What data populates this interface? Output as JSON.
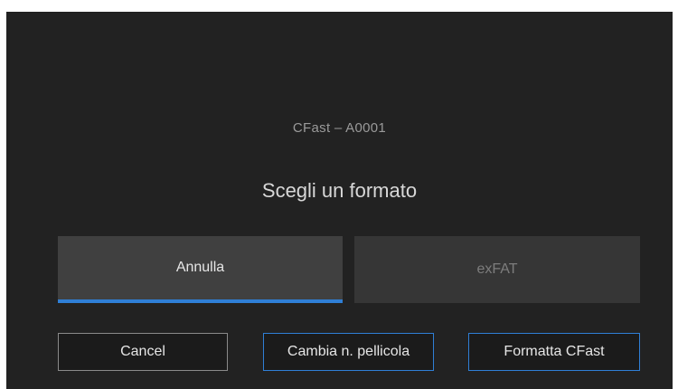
{
  "dialog": {
    "card_label": "CFast – A0001",
    "title": "Scegli un formato"
  },
  "choices": {
    "annulla": "Annulla",
    "exfat": "exFAT"
  },
  "buttons": {
    "cancel": "Cancel",
    "roll": "Cambia n. pellicola",
    "format": "Formatta CFast"
  },
  "colors": {
    "background": "#222222",
    "accent": "#2f7fd6"
  }
}
